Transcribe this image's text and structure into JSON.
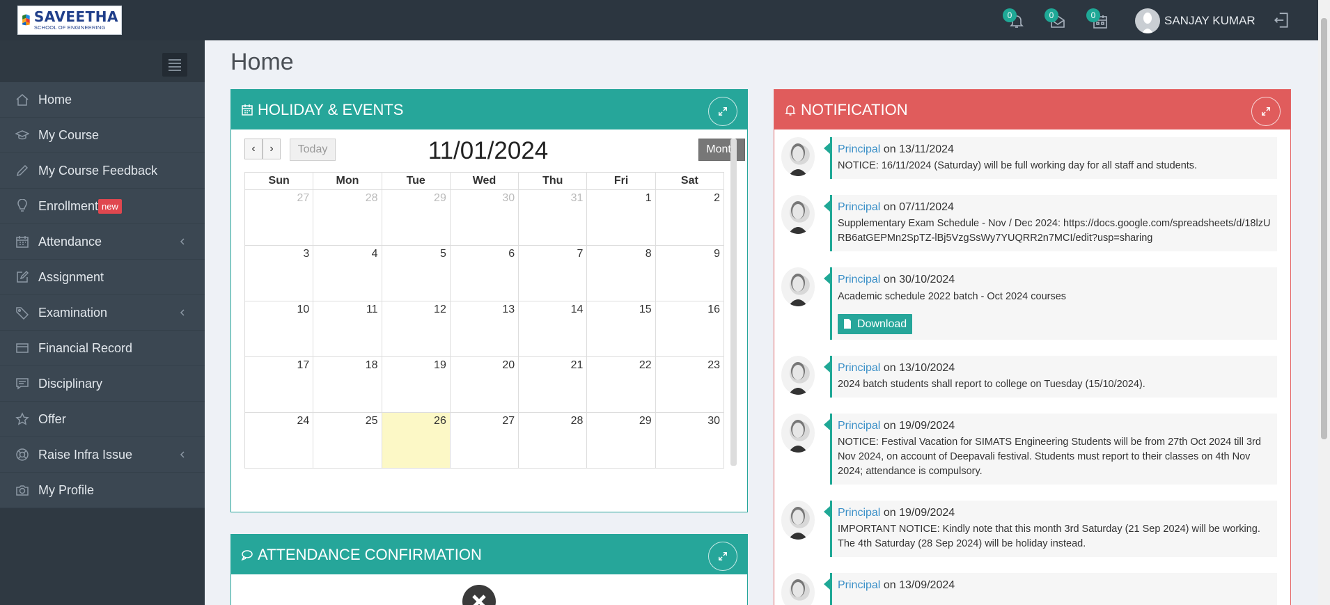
{
  "brand": {
    "name": "SAVEETHA",
    "subtitle": "SCHOOL OF ENGINEERING"
  },
  "topbar": {
    "notifications_count": "0",
    "messages_count": "0",
    "tasks_count": "0",
    "user_name": "SANJAY KUMAR",
    "icons": [
      "bell-icon",
      "envelope-icon",
      "calendar-icon",
      "logout-icon"
    ]
  },
  "sidebar": {
    "items": [
      {
        "label": "Home",
        "icon": "home-icon"
      },
      {
        "label": "My Course",
        "icon": "graduation-cap-icon"
      },
      {
        "label": "My Course Feedback",
        "icon": "pencil-icon"
      },
      {
        "label": "Enrollment",
        "icon": "lightbulb-icon",
        "badge": "new"
      },
      {
        "label": "Attendance",
        "icon": "calendar-grid-icon",
        "has_submenu": true
      },
      {
        "label": "Assignment",
        "icon": "edit-icon"
      },
      {
        "label": "Examination",
        "icon": "tag-icon",
        "has_submenu": true
      },
      {
        "label": "Financial Record",
        "icon": "credit-card-icon"
      },
      {
        "label": "Disciplinary",
        "icon": "comment-icon"
      },
      {
        "label": "Offer",
        "icon": "star-icon"
      },
      {
        "label": "Raise Infra Issue",
        "icon": "lifebuoy-icon",
        "has_submenu": true
      },
      {
        "label": "My Profile",
        "icon": "camera-icon"
      }
    ]
  },
  "page": {
    "title": "Home"
  },
  "events_panel": {
    "title": "HOLIDAY & EVENTS",
    "prev": "‹",
    "next": "›",
    "today_label": "Today",
    "calendar_title": "11/01/2024",
    "view_label": "Month",
    "weekdays": [
      "Sun",
      "Mon",
      "Tue",
      "Wed",
      "Thu",
      "Fri",
      "Sat"
    ],
    "weeks": [
      [
        "27",
        "28",
        "29",
        "30",
        "31",
        "1",
        "2"
      ],
      [
        "3",
        "4",
        "5",
        "6",
        "7",
        "8",
        "9"
      ],
      [
        "10",
        "11",
        "12",
        "13",
        "14",
        "15",
        "16"
      ],
      [
        "17",
        "18",
        "19",
        "20",
        "21",
        "22",
        "23"
      ],
      [
        "24",
        "25",
        "26",
        "27",
        "28",
        "29",
        "30"
      ]
    ],
    "highlighted_day": "26"
  },
  "attendance_panel": {
    "title": "ATTENDANCE CONFIRMATION"
  },
  "notification_panel": {
    "title": "NOTIFICATION",
    "items": [
      {
        "author": "Principal",
        "on": "on",
        "date": "13/11/2024",
        "text": "NOTICE: 16/11/2024 (Saturday) will be full working day for all staff and students."
      },
      {
        "author": "Principal",
        "on": "on",
        "date": "07/11/2024",
        "text": "Supplementary Exam Schedule - Nov / Dec 2024: https://docs.google.com/spreadsheets/d/18lzURB6atGEPMn2SpTZ-lBj5VzgSsWy7YUQRR2n7MCI/edit?usp=sharing"
      },
      {
        "author": "Principal",
        "on": "on",
        "date": "30/10/2024",
        "text": "Academic schedule 2022 batch - Oct 2024 courses",
        "download_label": "Download"
      },
      {
        "author": "Principal",
        "on": "on",
        "date": "13/10/2024",
        "text": "2024 batch students shall report to college on Tuesday (15/10/2024)."
      },
      {
        "author": "Principal",
        "on": "on",
        "date": "19/09/2024",
        "text": "NOTICE: Festival Vacation for SIMATS Engineering Students will be from 27th Oct 2024 till 3rd Nov 2024, on account of Deepavali festival. Students must report to their classes on 4th Nov 2024; attendance is compulsory."
      },
      {
        "author": "Principal",
        "on": "on",
        "date": "19/09/2024",
        "text": "IMPORTANT NOTICE: Kindly note that this month 3rd Saturday (21 Sep 2024) will be working. The 4th Saturday (28 Sep 2024) will be holiday instead."
      },
      {
        "author": "Principal",
        "on": "on",
        "date": "13/09/2024",
        "text": ""
      }
    ]
  },
  "colors": {
    "teal": "#26a69a",
    "red": "#e05c5c",
    "sidebar": "#3b4752",
    "topbar": "#2c3640",
    "highlight": "#fcf8c6"
  }
}
